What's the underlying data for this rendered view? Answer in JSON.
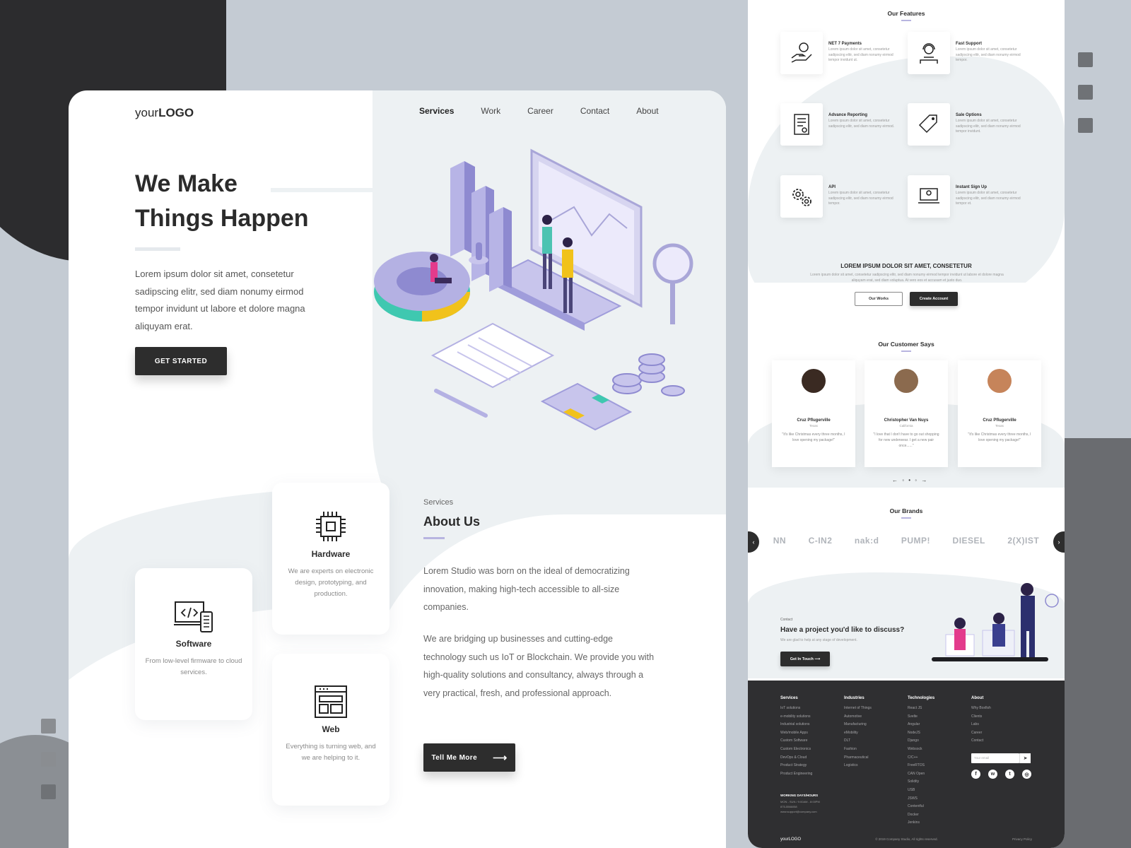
{
  "brand": {
    "logo_light": "your",
    "logo_bold": "LOGO"
  },
  "nav": {
    "items": [
      "Services",
      "Work",
      "Career",
      "Contact",
      "About"
    ],
    "active": "Services"
  },
  "hero": {
    "title_line1": "We Make",
    "title_line2": "Things Happen",
    "text": "Lorem ipsum dolor sit amet, consetetur sadipscing elitr, sed diam nonumy eirmod tempor invidunt ut labore et dolore magna aliquyam erat.",
    "cta": "GET STARTED"
  },
  "services": {
    "hardware": {
      "title": "Hardware",
      "desc": "We are experts on electronic design, prototyping, and production."
    },
    "software": {
      "title": "Software",
      "desc": "From low-level firmware to cloud services."
    },
    "web": {
      "title": "Web",
      "desc": "Everything is turning web, and we are helping to it."
    }
  },
  "about": {
    "kicker": "Services",
    "title": "About Us",
    "p1": "Lorem Studio was born on the ideal of democratizing innovation, making high-tech accessible to all-size companies.",
    "p2": "We are bridging up businesses and cutting-edge technology such us IoT or Blockchain. We provide you with high-quality solutions and consultancy, always through a very practical, fresh, and professional approach.",
    "cta": "Tell Me More"
  },
  "side": {
    "features_title": "Our Features",
    "features": [
      {
        "title": "NET 7 Payments",
        "desc": "Lorem ipsum dolor sit amet, consetetur sadipscing elitr, sed diam nonumy eirmod tempor invidunt ut."
      },
      {
        "title": "Fast Support",
        "desc": "Lorem ipsum dolor sit amet, consetetur sadipscing elitr, sed diam nonumy eirmod tempor."
      },
      {
        "title": "Advance Reporting",
        "desc": "Lorem ipsum dolor sit amet, consetetur sadipscing elitr, sed diam nonumy eirmod."
      },
      {
        "title": "Sale Options",
        "desc": "Lorem ipsum dolor sit amet, consetetur sadipscing elitr, sed diam nonumy eirmod tempor invidunt."
      },
      {
        "title": "API",
        "desc": "Lorem ipsum dolor sit amet, consetetur sadipscing elitr, sed diam nonumy eirmod tempor."
      },
      {
        "title": "Instant Sign Up",
        "desc": "Lorem ipsum dolor sit amet, consetetur sadipscing elitr, sed diam nonumy eirmod tempor et."
      }
    ],
    "cta_title": "LOREM IPSUM DOLOR SIT AMET, CONSETETUR",
    "cta_text": "Lorem ipsum dolor sit amet, consetetur sadipscing elitr, sed diam nonumy eirmod tempor invidunt ut labore et dolore magna aliquyam erat, sed diam voluptua. At vero eos et accusam et justo duo.",
    "btn_works": "Our Works",
    "btn_create": "Create Account",
    "testimonials_title": "Our Customer Says",
    "testimonials": [
      {
        "name": "Cruz Pflugerville",
        "loc": "Texas",
        "quote": "\"It's like Christmas every three months, I love opening my package!\""
      },
      {
        "name": "Christopher Van Nuys",
        "loc": "California",
        "quote": "\"I love that I don't have to go out shopping for new underwear. I get a new pair once......\""
      },
      {
        "name": "Cruz Pflugerville",
        "loc": "Texas",
        "quote": "\"It's like Christmas every three months, I love opening my package!\""
      }
    ],
    "dots": "← ◦ • ◦ →",
    "brands_title": "Our Brands",
    "brands": [
      "NN",
      "C-IN2",
      "nak:d",
      "PUMP!",
      "DIESEL",
      "2(X)IST"
    ],
    "contact_kicker": "Contact",
    "contact_title": "Have a project you'd like to discuss?",
    "contact_desc": "We are glad to help at any stage of development.",
    "contact_btn": "Get In Touch  ⟶"
  },
  "footer": {
    "cols": [
      {
        "title": "Services",
        "items": [
          "IoT solutions",
          "e-mobility solutions",
          "Industrial solutions",
          "Web/mobile Apps",
          "Custom Software",
          "Custom Electronics",
          "DevOps & Cloud",
          "Product Strategy",
          "Product Engineering"
        ]
      },
      {
        "title": "Industries",
        "items": [
          "Internet of Things",
          "Automotive",
          "Manufacturing",
          "eMobility",
          "DLT",
          "Fashion",
          "Pharmaceutical",
          "Logistics"
        ]
      },
      {
        "title": "Technologies",
        "items": [
          "React JS",
          "Svelte",
          "Angular",
          "NodeJS",
          "Django",
          "Websock",
          "C/C++",
          "FreeRTOS",
          "CAN Open",
          "Solidity",
          "USB",
          "JSWS",
          "Contentful",
          "Docker",
          "Jenkins"
        ]
      },
      {
        "title": "About",
        "items": [
          "Why Boxfish",
          "Clients",
          "Labs",
          "Career",
          "Contact"
        ]
      }
    ],
    "email_placeholder": "Your email",
    "hours_title": "WORKING DAYS/HOURS",
    "hours": "MON - SUN / 9:00AM - 8:00PM",
    "phone": "875-5566058",
    "email": "www.support@company.com",
    "logo": "yourLOGO",
    "copyright": "© 2019 Company Studio, All rights reserved.",
    "privacy": "Privacy Policy"
  },
  "colors": {
    "accent": "#b8b5e0",
    "dark": "#2d2d2d",
    "bg": "#c4cbd3"
  }
}
